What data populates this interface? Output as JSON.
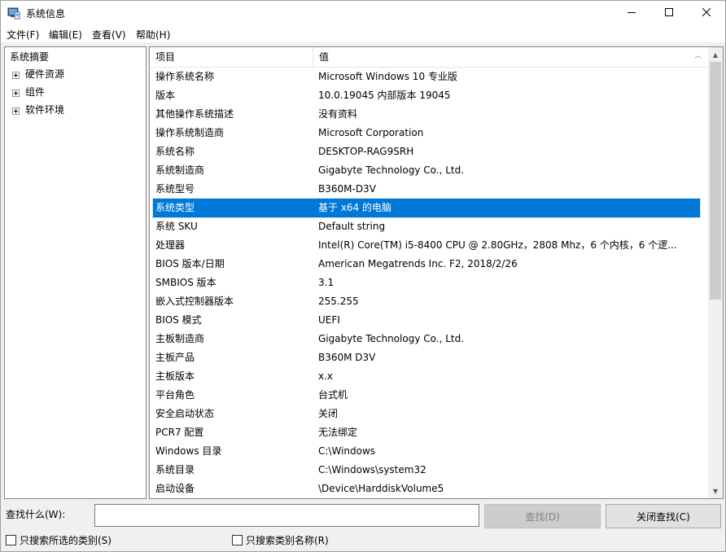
{
  "window": {
    "title": "系统信息",
    "app_icon": "system-information-icon",
    "controls": {
      "minimize": "minimize-icon",
      "maximize": "maximize-icon",
      "close": "close-icon"
    }
  },
  "menu": [
    {
      "label": "文件(F)"
    },
    {
      "label": "编辑(E)"
    },
    {
      "label": "查看(V)"
    },
    {
      "label": "帮助(H)"
    }
  ],
  "tree": {
    "root": "系统摘要",
    "children": [
      {
        "label": "硬件资源"
      },
      {
        "label": "组件"
      },
      {
        "label": "软件环境"
      }
    ]
  },
  "table": {
    "columns": [
      "项目",
      "值"
    ],
    "selected_index": 7,
    "rows": [
      {
        "name": "操作系统名称",
        "value": "Microsoft Windows 10 专业版"
      },
      {
        "name": "版本",
        "value": "10.0.19045 内部版本 19045"
      },
      {
        "name": "其他操作系统描述",
        "value": "没有资料"
      },
      {
        "name": "操作系统制造商",
        "value": "Microsoft Corporation"
      },
      {
        "name": "系统名称",
        "value": "DESKTOP-RAG9SRH"
      },
      {
        "name": "系统制造商",
        "value": "Gigabyte Technology Co., Ltd."
      },
      {
        "name": "系统型号",
        "value": "B360M-D3V"
      },
      {
        "name": "系统类型",
        "value": "基于 x64 的电脑"
      },
      {
        "name": "系统 SKU",
        "value": "Default string"
      },
      {
        "name": "处理器",
        "value": "Intel(R) Core(TM) i5-8400 CPU @ 2.80GHz，2808 Mhz，6 个内核，6 个逻..."
      },
      {
        "name": "BIOS 版本/日期",
        "value": "American Megatrends Inc. F2, 2018/2/26"
      },
      {
        "name": "SMBIOS 版本",
        "value": "3.1"
      },
      {
        "name": "嵌入式控制器版本",
        "value": "255.255"
      },
      {
        "name": "BIOS 模式",
        "value": "UEFI"
      },
      {
        "name": "主板制造商",
        "value": "Gigabyte Technology Co., Ltd."
      },
      {
        "name": "主板产品",
        "value": "B360M D3V"
      },
      {
        "name": "主板版本",
        "value": "x.x"
      },
      {
        "name": "平台角色",
        "value": "台式机"
      },
      {
        "name": "安全启动状态",
        "value": "关闭"
      },
      {
        "name": "PCR7 配置",
        "value": "无法绑定"
      },
      {
        "name": "Windows 目录",
        "value": "C:\\Windows"
      },
      {
        "name": "系统目录",
        "value": "C:\\Windows\\system32"
      },
      {
        "name": "启动设备",
        "value": "\\Device\\HarddiskVolume5"
      }
    ]
  },
  "find": {
    "label": "查找什么(W):",
    "input_value": "",
    "find_button": "查找(D)",
    "close_find_button": "关闭查找(C)",
    "search_selected_label": "只搜索所选的类别(S)",
    "search_names_label": "只搜索类别名称(R)"
  },
  "colors": {
    "selection": "#0078d7",
    "window_bg": "#f0f0f0"
  }
}
